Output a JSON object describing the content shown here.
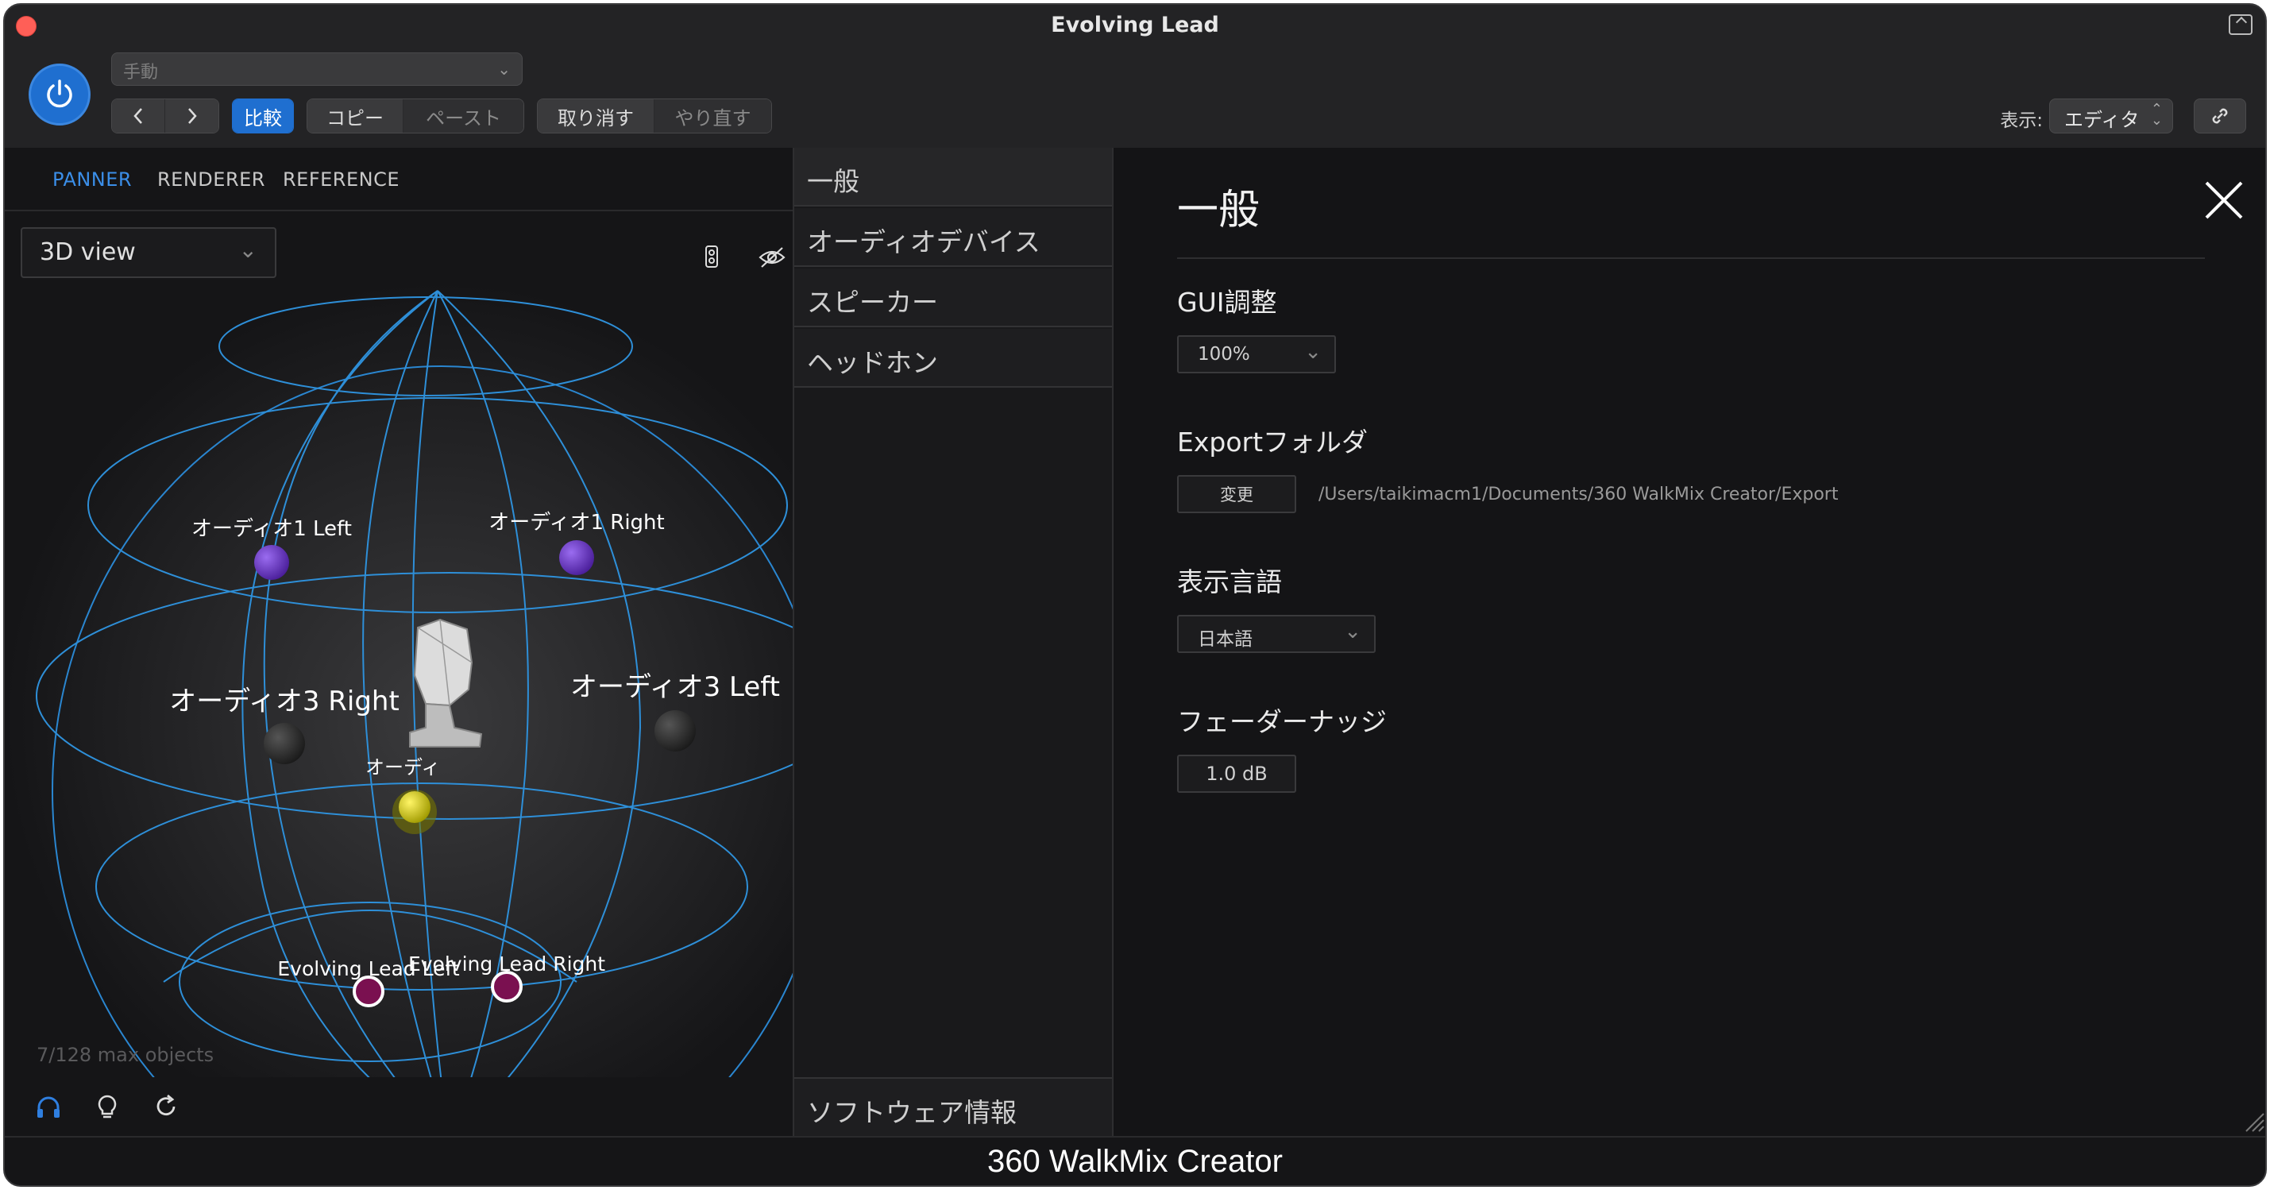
{
  "window": {
    "title": "Evolving Lead"
  },
  "toolbar": {
    "preset": "手動",
    "compare_label": "比較",
    "copy_label": "コピー",
    "paste_label": "ペースト",
    "undo_label": "取り消す",
    "redo_label": "やり直す",
    "view_label": "表示:",
    "view_value": "エディタ"
  },
  "left": {
    "tabs": [
      "PANNER",
      "RENDERER",
      "REFERENCE"
    ],
    "active_tab": "PANNER",
    "view_mode": "3D view",
    "objects": [
      {
        "label": "オーディオ1 Left",
        "color": "purple"
      },
      {
        "label": "オーディオ1 Right",
        "color": "purple"
      },
      {
        "label": "オーディオ3 Right",
        "color": "dark"
      },
      {
        "label": "オーディオ3 Left",
        "color": "dark"
      },
      {
        "label": "オーディ",
        "color": "yellow"
      },
      {
        "label": "Evolving Lead Left",
        "color": "magenta"
      },
      {
        "label": "Evolving Lead Right",
        "color": "magenta"
      }
    ],
    "object_count": "7/128 max objects"
  },
  "middle": {
    "items": [
      "一般",
      "オーディオデバイス",
      "スピーカー",
      "ヘッドホン"
    ],
    "bottom_item": "ソフトウェア情報"
  },
  "settings": {
    "title": "一般",
    "gui_scale_title": "GUI調整",
    "gui_scale_value": "100%",
    "export_title": "Exportフォルダ",
    "change_label": "変更",
    "export_path": "/Users/taikimacm1/Documents/360 WalkMix Creator/Export",
    "language_title": "表示言語",
    "language_value": "日本語",
    "fader_title": "フェーダーナッジ",
    "fader_value": "1.0 dB"
  },
  "footer": {
    "product": "360 WalkMix Creator"
  },
  "colors": {
    "accent": "#1f6fd0",
    "tab_active": "#3b8ee8",
    "sphere_line": "#2e8fd8"
  }
}
